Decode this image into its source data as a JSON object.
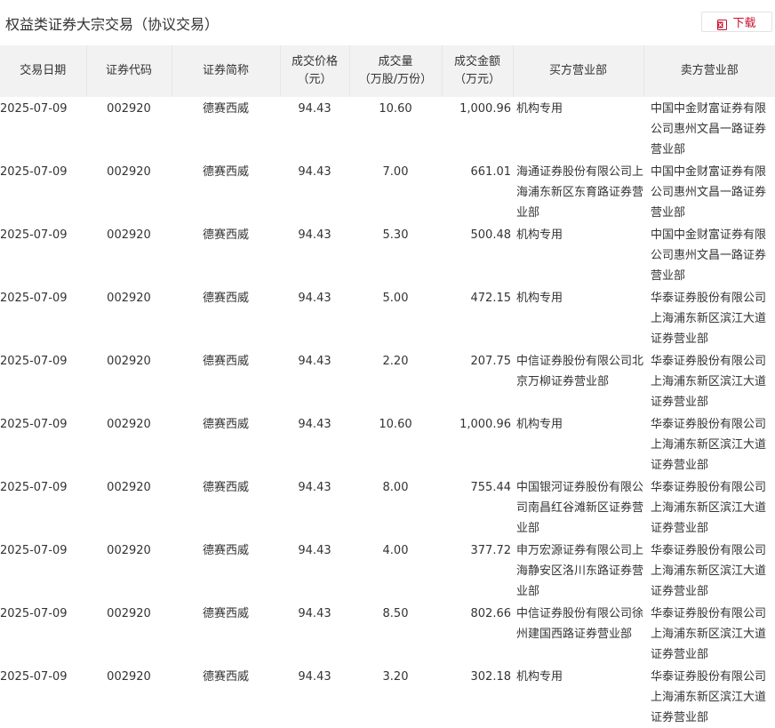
{
  "header": {
    "title": "权益类证券大宗交易（协议交易）",
    "download_label": "下载",
    "download_icon": "excel-download-icon"
  },
  "colors": {
    "accent": "#c8102e",
    "header_bg": "#f2f2f2"
  },
  "table": {
    "columns": [
      [
        "交易日期"
      ],
      [
        "证券代码"
      ],
      [
        "证券简称"
      ],
      [
        "成交价格",
        "（元）"
      ],
      [
        "成交量",
        "（万股/万份）"
      ],
      [
        "成交金额",
        "（万元）"
      ],
      [
        "买方营业部"
      ],
      [
        "卖方营业部"
      ]
    ],
    "rows": [
      [
        "2025-07-09",
        "002920",
        "德赛西威",
        "94.43",
        "10.60",
        "1,000.96",
        "机构专用",
        "中国中金财富证券有限公司惠州文昌一路证券营业部"
      ],
      [
        "2025-07-09",
        "002920",
        "德赛西威",
        "94.43",
        "7.00",
        "661.01",
        "海通证券股份有限公司上海浦东新区东育路证券营业部",
        "中国中金财富证券有限公司惠州文昌一路证券营业部"
      ],
      [
        "2025-07-09",
        "002920",
        "德赛西威",
        "94.43",
        "5.30",
        "500.48",
        "机构专用",
        "中国中金财富证券有限公司惠州文昌一路证券营业部"
      ],
      [
        "2025-07-09",
        "002920",
        "德赛西威",
        "94.43",
        "5.00",
        "472.15",
        "机构专用",
        "华泰证券股份有限公司上海浦东新区滨江大道证券营业部"
      ],
      [
        "2025-07-09",
        "002920",
        "德赛西威",
        "94.43",
        "2.20",
        "207.75",
        "中信证券股份有限公司北京万柳证券营业部",
        "华泰证券股份有限公司上海浦东新区滨江大道证券营业部"
      ],
      [
        "2025-07-09",
        "002920",
        "德赛西威",
        "94.43",
        "10.60",
        "1,000.96",
        "机构专用",
        "华泰证券股份有限公司上海浦东新区滨江大道证券营业部"
      ],
      [
        "2025-07-09",
        "002920",
        "德赛西威",
        "94.43",
        "8.00",
        "755.44",
        "中国银河证券股份有限公司南昌红谷滩新区证券营业部",
        "华泰证券股份有限公司上海浦东新区滨江大道证券营业部"
      ],
      [
        "2025-07-09",
        "002920",
        "德赛西威",
        "94.43",
        "4.00",
        "377.72",
        "申万宏源证券有限公司上海静安区洛川东路证券营业部",
        "华泰证券股份有限公司上海浦东新区滨江大道证券营业部"
      ],
      [
        "2025-07-09",
        "002920",
        "德赛西威",
        "94.43",
        "8.50",
        "802.66",
        "中信证券股份有限公司徐州建国西路证券营业部",
        "华泰证券股份有限公司上海浦东新区滨江大道证券营业部"
      ],
      [
        "2025-07-09",
        "002920",
        "德赛西威",
        "94.43",
        "3.20",
        "302.18",
        "机构专用",
        "华泰证券股份有限公司上海浦东新区滨江大道证券营业部"
      ]
    ]
  }
}
